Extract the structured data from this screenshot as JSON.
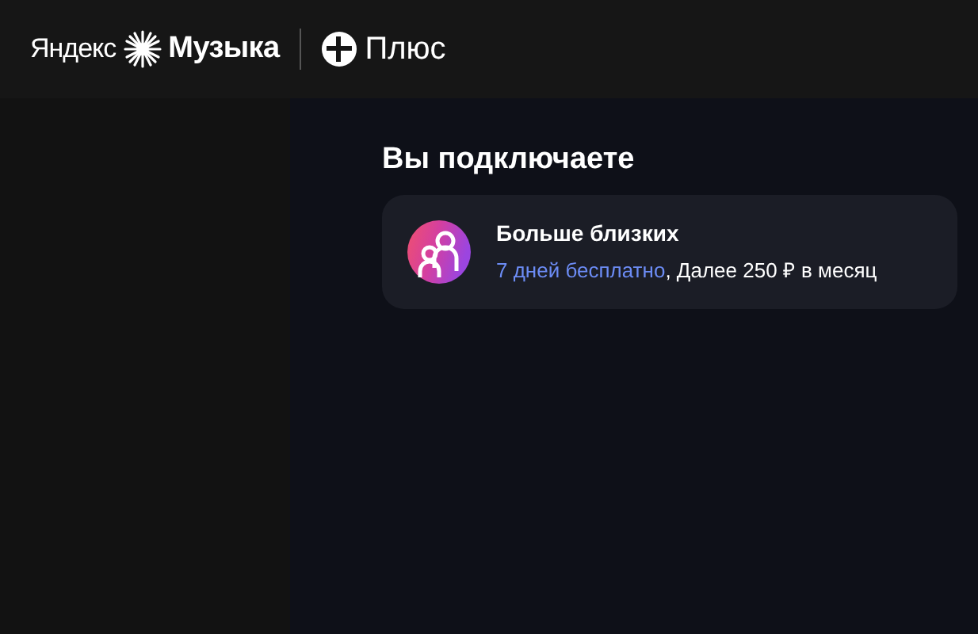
{
  "header": {
    "brand": "Яндекс",
    "product": "Музыка",
    "plus": "Плюс"
  },
  "heading": "Вы подключаете",
  "offer": {
    "title": "Больше близких",
    "trial_link": "7 дней бесплатно",
    "price_text": ", Далее 250 ₽ в месяц"
  }
}
